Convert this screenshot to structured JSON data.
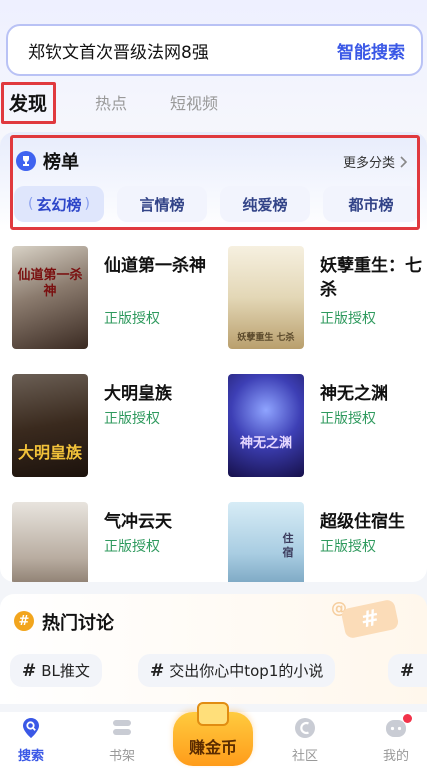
{
  "search": {
    "query": "郑钦文首次晋级法网8强",
    "button": "智能搜索"
  },
  "tabs": [
    {
      "label": "发现",
      "active": true
    },
    {
      "label": "热点",
      "active": false
    },
    {
      "label": "短视频",
      "active": false
    }
  ],
  "ranking": {
    "title": "榜单",
    "more": "更多分类",
    "chips": [
      {
        "label": "玄幻榜",
        "active": true
      },
      {
        "label": "言情榜",
        "active": false
      },
      {
        "label": "纯爱榜",
        "active": false
      },
      {
        "label": "都市榜",
        "active": false
      }
    ],
    "books": [
      {
        "title": "仙道第一杀神",
        "tag": "正版授权",
        "cover_text": "仙道第一杀神"
      },
      {
        "title": "妖孽重生：七杀",
        "tag": "正版授权",
        "cover_text": "妖孽重生 七杀"
      },
      {
        "title": "大明皇族",
        "tag": "正版授权",
        "cover_text": "大明皇族"
      },
      {
        "title": "神无之渊",
        "tag": "正版授权",
        "cover_text": "神无之渊"
      },
      {
        "title": "气冲云天",
        "tag": "正版授权",
        "cover_text": ""
      },
      {
        "title": "超级住宿生",
        "tag": "正版授权",
        "cover_text": "住宿"
      }
    ]
  },
  "discuss": {
    "title": "热门讨论",
    "topics": [
      "BL推文",
      "交出你心中top1的小说",
      ""
    ]
  },
  "nav": {
    "items": [
      {
        "label": "搜索",
        "icon": "search-location-icon",
        "active": true
      },
      {
        "label": "书架",
        "icon": "bookshelf-icon",
        "active": false
      },
      {
        "label": "赚金币",
        "icon": "coin-book-icon",
        "active": false
      },
      {
        "label": "社区",
        "icon": "community-icon",
        "active": false
      },
      {
        "label": "我的",
        "icon": "profile-icon",
        "active": false
      }
    ]
  },
  "colors": {
    "accent": "#3a58e6",
    "licensed": "#2f9a5e",
    "highlight_box": "#e0393e",
    "coin": "#ffb02e"
  }
}
